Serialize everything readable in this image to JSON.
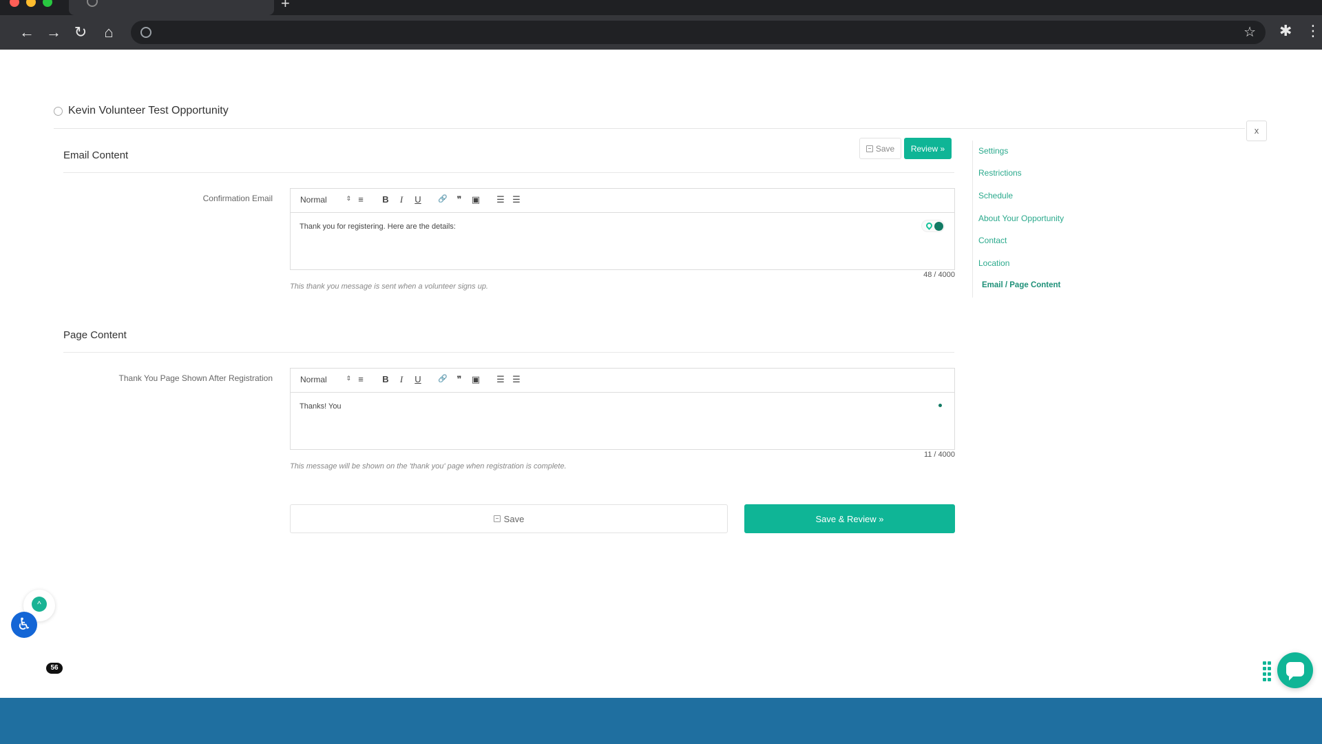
{
  "browser": {
    "new_tab_symbol": "+",
    "back_icon": "←",
    "forward_icon": "→",
    "reload_icon": "↻",
    "home_icon": "⌂",
    "star_icon": "☆",
    "extensions_icon": "✱",
    "menu_icon": "⋮"
  },
  "opportunity": {
    "title": "Kevin Volunteer Test Opportunity",
    "close_label": "x"
  },
  "top_actions": {
    "save_label": "Save",
    "review_label": "Review »"
  },
  "email_section": {
    "title": "Email Content",
    "field_label": "Confirmation Email",
    "editor": {
      "format": "Normal",
      "content": "Thank you for registering. Here are the details:",
      "counter": "48 / 4000"
    },
    "hint": "This thank you message is sent when a volunteer signs up."
  },
  "page_section": {
    "title": "Page Content",
    "field_label": "Thank You Page Shown After Registration",
    "editor": {
      "format": "Normal",
      "content": "Thanks! You",
      "counter": "11 / 4000"
    },
    "hint": "This message will be shown on the 'thank you' page when registration is complete."
  },
  "toolbar_icons": {
    "bold": "B",
    "italic": "I",
    "underline": "U",
    "align": "≡",
    "link": "🔗",
    "quote": "❞",
    "image": "▣",
    "ordered_list": "☰",
    "bullet_list": "☰",
    "arrows": "⇕"
  },
  "sidenav": {
    "items": [
      {
        "label": "Settings"
      },
      {
        "label": "Restrictions"
      },
      {
        "label": "Schedule"
      },
      {
        "label": "About Your Opportunity"
      },
      {
        "label": "Contact"
      },
      {
        "label": "Location"
      },
      {
        "label": "Email / Page Content"
      }
    ]
  },
  "bottom_actions": {
    "save_label": "Save",
    "save_review_label": "Save & Review »"
  },
  "widgets": {
    "accessibility_icon": "♿",
    "up_icon": "^",
    "badge_count": "56"
  },
  "colors": {
    "accent": "#0fb596",
    "nav_link": "#2aa98c",
    "footer": "#1f6fa0"
  }
}
